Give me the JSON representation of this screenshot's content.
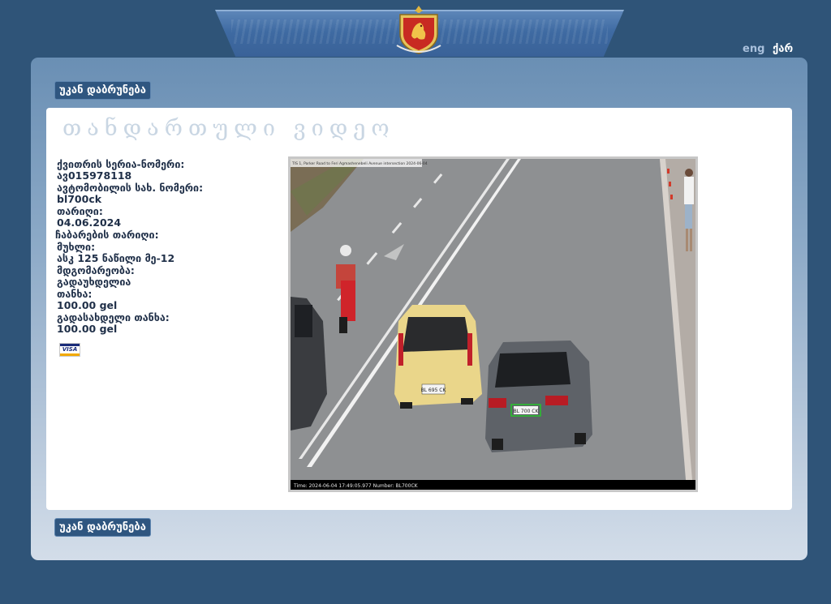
{
  "header": {
    "emblem_icon": "georgia-police-emblem",
    "lang_eng": "eng",
    "lang_geo": "ქარ"
  },
  "nav": {
    "back_label": "უკან დაბრუნება"
  },
  "page": {
    "title": "თანდართული ვიდეო"
  },
  "fields": [
    {
      "label": "ქვითრის სერია-ნომერი:",
      "value": "ავ015978118"
    },
    {
      "label": "ავტომობილის სახ. ნომერი:",
      "value": "bl700ck"
    },
    {
      "label": "თარიღი:",
      "value": "04.06.2024"
    },
    {
      "label": "ჩაბარების თარიღი:",
      "value": ""
    },
    {
      "label": "მუხლი:",
      "value": "ასკ 125 ნაწილი მე-12"
    },
    {
      "label": "მდგომარეობა:",
      "value": "გადაუხდელია"
    },
    {
      "label": "თანხა:",
      "value": "100.00 gel"
    },
    {
      "label": "გადასახდელი თანხა:",
      "value": "100.00 gel"
    }
  ],
  "payment": {
    "card_icon": "visa-card-icon",
    "card_label": "VISA"
  },
  "video": {
    "overlay_top": "TIS 1, Parker Road to Feri Agmashenebeli Avenue intersection 2024-06-04",
    "overlay_bottom": "Time: 2024-06-04 17:49:05.977 Number: BL700CK",
    "plate_front": "BL 695 CK",
    "plate_target": "BL 700 CK"
  },
  "colors": {
    "background": "#2f5478",
    "button": "#2f5680",
    "text": "#1f2f48",
    "title": "#c9d6e3"
  }
}
